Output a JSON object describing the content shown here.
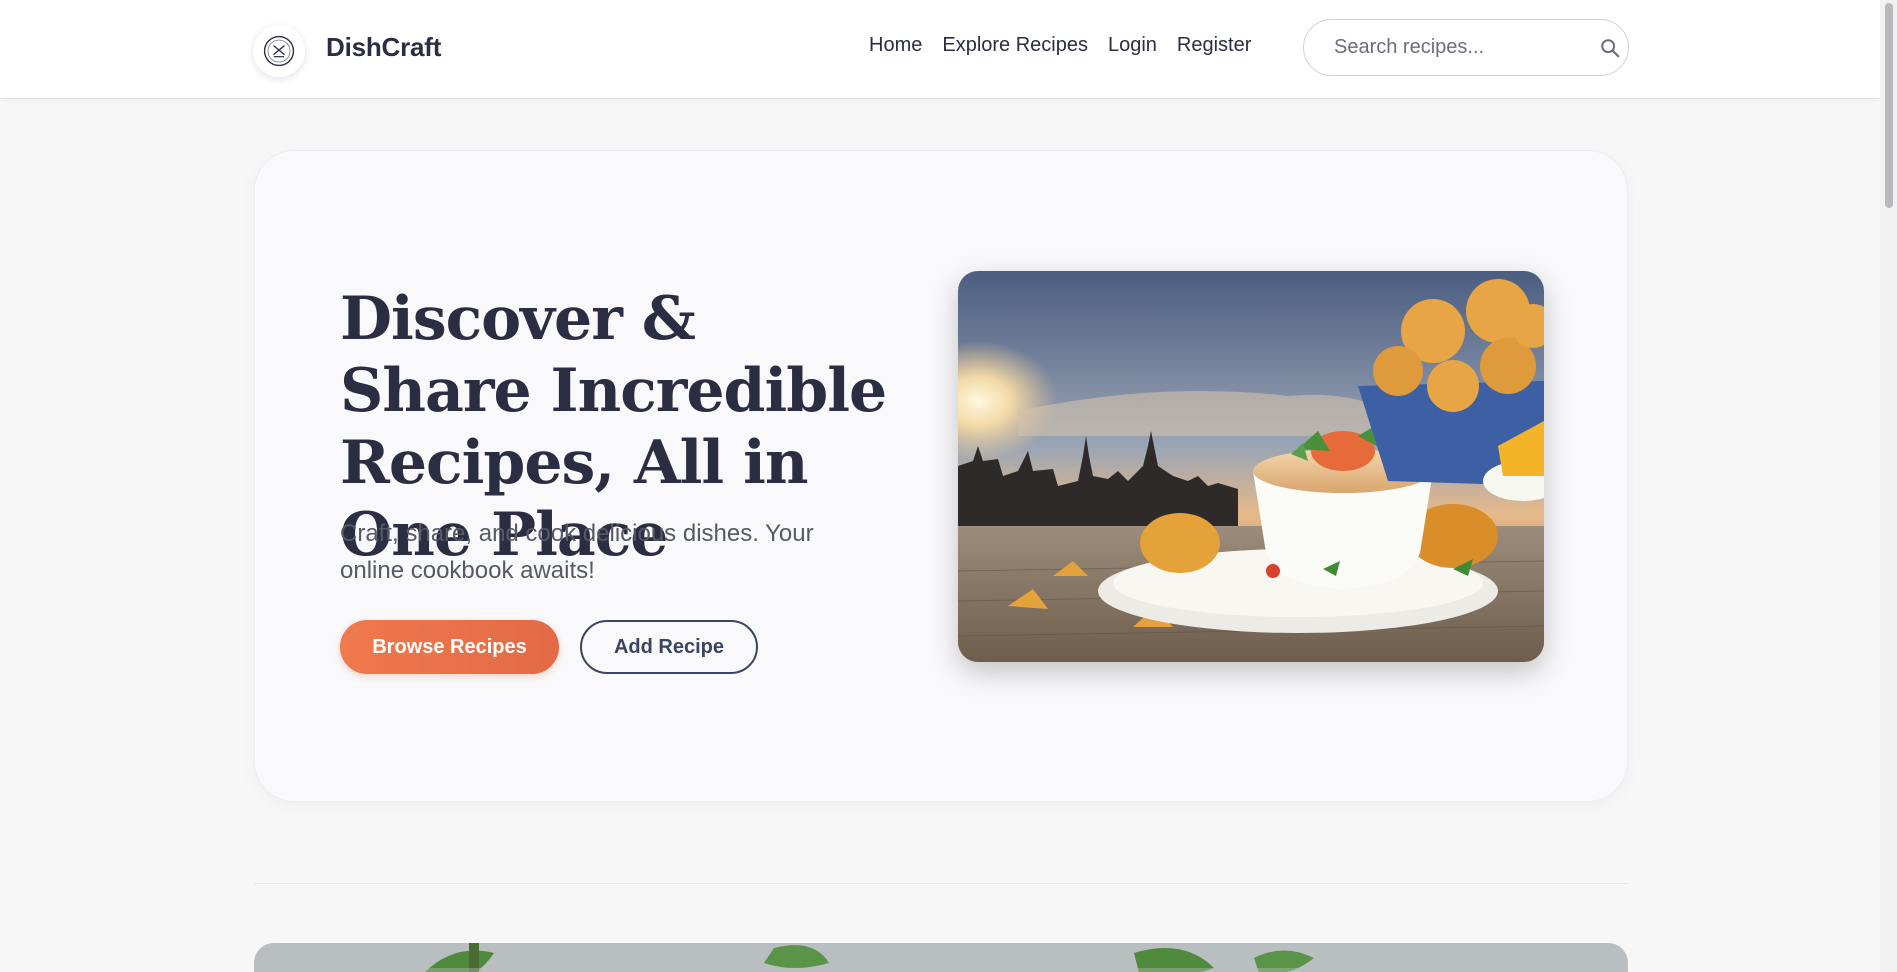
{
  "header": {
    "brand_name": "DishCraft",
    "logo_icon": "chef-plate-logo-icon",
    "nav": [
      {
        "label": "Home"
      },
      {
        "label": "Explore Recipes"
      },
      {
        "label": "Login"
      },
      {
        "label": "Register"
      }
    ],
    "search": {
      "placeholder": "Search recipes...",
      "value": "",
      "icon": "search-icon"
    }
  },
  "hero": {
    "title": "Discover & Share Incredible Recipes, All in One Place",
    "subtitle": "Craft, share, and cook delicious dishes. Your online cookbook awaits!",
    "primary_button": "Browse Recipes",
    "secondary_button": "Add Recipe",
    "image": "bowl-of-soup-with-fried-snacks-at-sunset-image"
  },
  "featured": {
    "image": "mint-leaves-on-ice-banner-image"
  },
  "colors": {
    "accent": "#ef7a4c",
    "text": "#2b2d42",
    "secondary": "#3b4563",
    "background": "#f7f7f8"
  }
}
